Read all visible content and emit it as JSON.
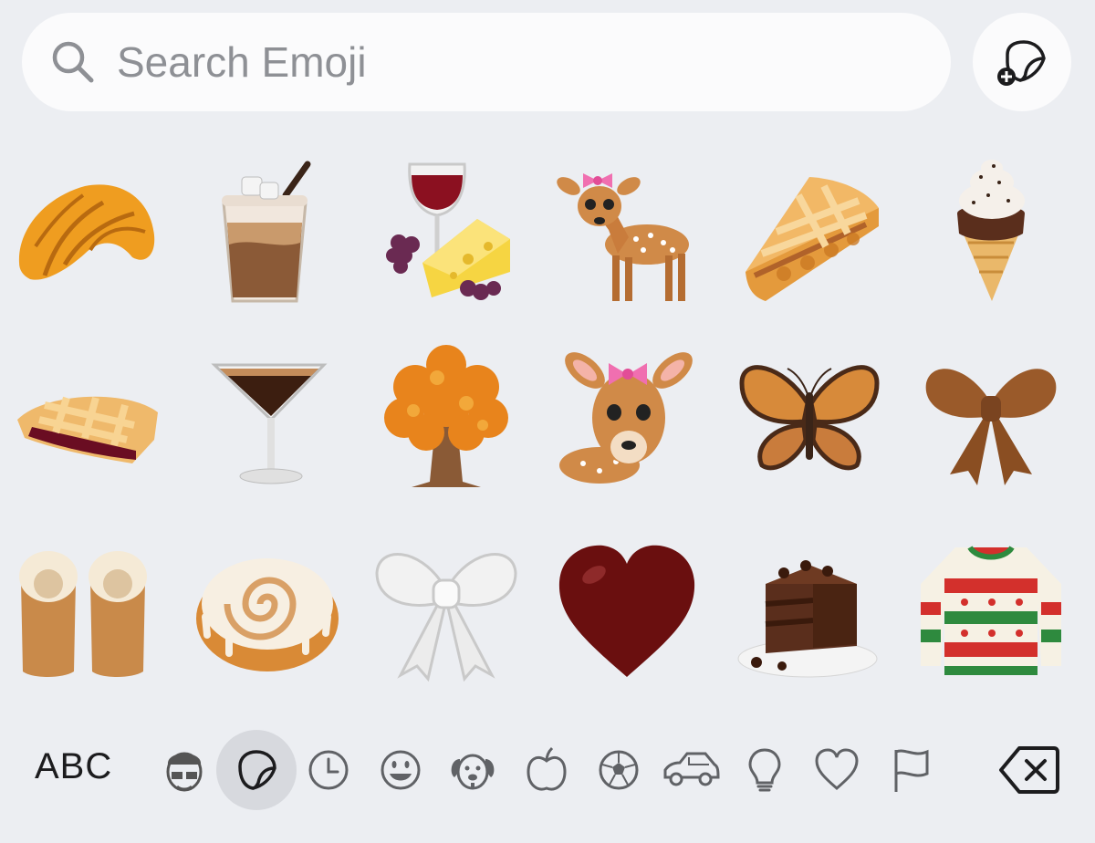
{
  "search": {
    "placeholder": "Search Emoji"
  },
  "bottom_bar": {
    "abc_label": "ABC"
  },
  "stickers": [
    "croissant",
    "iced-coffee",
    "wine-and-cheese",
    "fawn-with-pink-bow",
    "lattice-pie-slice",
    "soft-serve-cone",
    "cherry-pie",
    "espresso-martini",
    "autumn-tree",
    "fawn-portrait",
    "monarch-butterfly",
    "brown-bow",
    "shearling-slippers",
    "cinnamon-roll",
    "white-bow",
    "dark-red-heart",
    "chocolate-cake",
    "holiday-sweater"
  ],
  "categories": [
    "memoji-icon",
    "stickers-icon",
    "recent-icon",
    "smileys-icon",
    "animals-icon",
    "food-icon",
    "activity-icon",
    "travel-icon",
    "objects-icon",
    "symbols-icon",
    "flags-icon"
  ],
  "colors": {
    "background": "#eceef2",
    "field": "#fbfbfc",
    "icon": "#606266",
    "active": "#d7d9de"
  }
}
